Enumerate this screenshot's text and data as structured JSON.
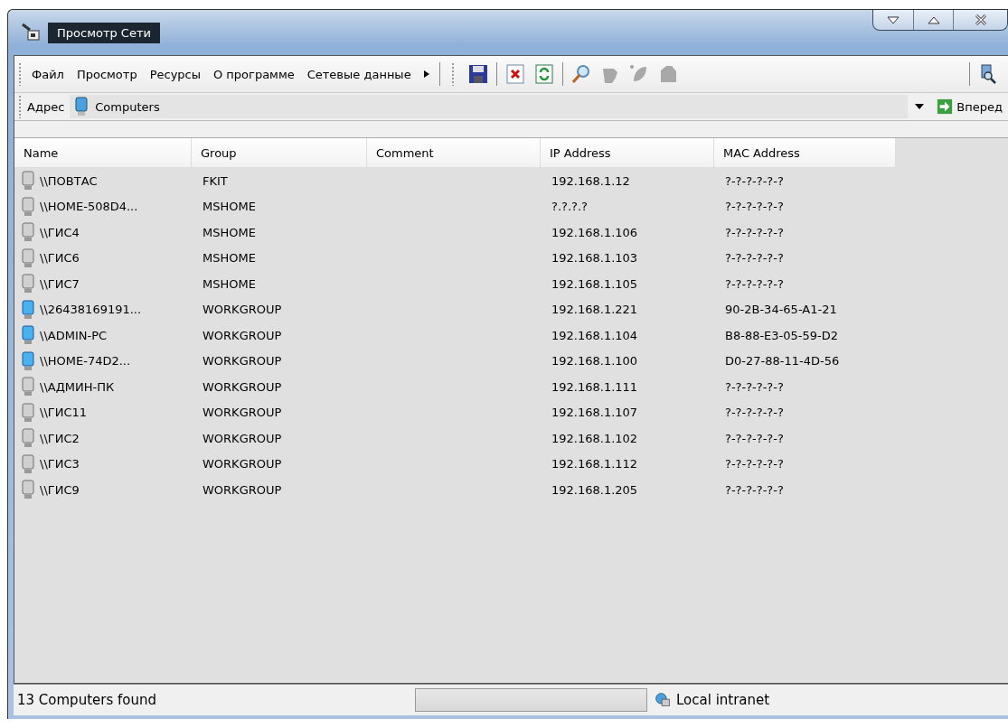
{
  "window": {
    "title": "Просмотр Сети"
  },
  "menu": [
    "Файл",
    "Просмотр",
    "Ресурсы",
    "О программе",
    "Сетевые данные"
  ],
  "address_bar": {
    "label": "Адрес",
    "value": "Computers",
    "go_button": "Вперед"
  },
  "table": {
    "columns": [
      "Name",
      "Group",
      "Comment",
      "IP Address",
      "MAC Address"
    ],
    "rows": [
      {
        "online": false,
        "cells": [
          "\\\\ПОВТАС",
          "FKIT",
          "",
          "192.168.1.12",
          "?-?-?-?-?-?"
        ]
      },
      {
        "online": false,
        "cells": [
          "\\\\HOME-508D4...",
          "MSHOME",
          "",
          "?.?.?.?",
          "?-?-?-?-?-?"
        ]
      },
      {
        "online": false,
        "cells": [
          "\\\\ГИС4",
          "MSHOME",
          "",
          "192.168.1.106",
          "?-?-?-?-?-?"
        ]
      },
      {
        "online": false,
        "cells": [
          "\\\\ГИС6",
          "MSHOME",
          "",
          "192.168.1.103",
          "?-?-?-?-?-?"
        ]
      },
      {
        "online": false,
        "cells": [
          "\\\\ГИС7",
          "MSHOME",
          "",
          "192.168.1.105",
          "?-?-?-?-?-?"
        ]
      },
      {
        "online": true,
        "cells": [
          "\\\\26438169191...",
          "WORKGROUP",
          "",
          "192.168.1.221",
          "90-2B-34-65-A1-21"
        ]
      },
      {
        "online": true,
        "cells": [
          "\\\\ADMIN-PC",
          "WORKGROUP",
          "",
          "192.168.1.104",
          "B8-88-E3-05-59-D2"
        ]
      },
      {
        "online": true,
        "cells": [
          "\\\\HOME-74D2...",
          "WORKGROUP",
          "",
          "192.168.1.100",
          "D0-27-88-11-4D-56"
        ]
      },
      {
        "online": false,
        "cells": [
          "\\\\АДМИН-ПК",
          "WORKGROUP",
          "",
          "192.168.1.111",
          "?-?-?-?-?-?"
        ]
      },
      {
        "online": false,
        "cells": [
          "\\\\ГИС11",
          "WORKGROUP",
          "",
          "192.168.1.107",
          "?-?-?-?-?-?"
        ]
      },
      {
        "online": false,
        "cells": [
          "\\\\ГИС2",
          "WORKGROUP",
          "",
          "192.168.1.102",
          "?-?-?-?-?-?"
        ]
      },
      {
        "online": false,
        "cells": [
          "\\\\ГИС3",
          "WORKGROUP",
          "",
          "192.168.1.112",
          "?-?-?-?-?-?"
        ]
      },
      {
        "online": false,
        "cells": [
          "\\\\ГИС9",
          "WORKGROUP",
          "",
          "192.168.1.205",
          "?-?-?-?-?-?"
        ]
      }
    ]
  },
  "status_bar": {
    "message": "13 Computers found",
    "progress": {
      "level": 0
    },
    "zone": "Local intranet"
  }
}
